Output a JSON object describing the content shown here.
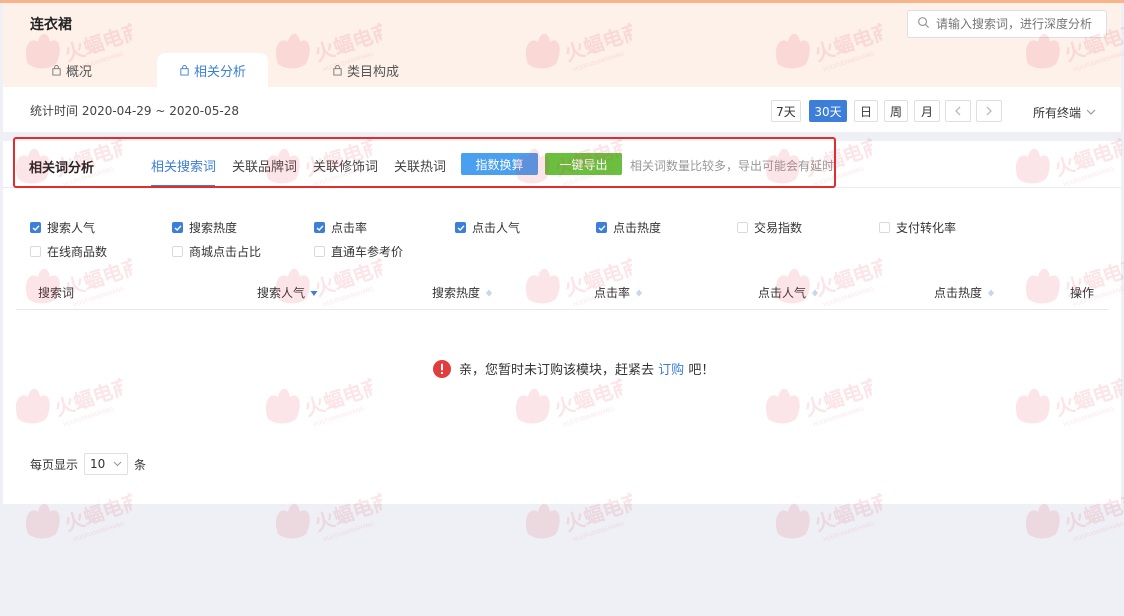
{
  "category_title": "连衣裙",
  "search": {
    "placeholder": "请输入搜索词，进行深度分析"
  },
  "tabs": [
    {
      "label": "概况",
      "icon": "bag-icon",
      "active": false
    },
    {
      "label": "相关分析",
      "icon": "bag-icon",
      "active": true
    },
    {
      "label": "类目构成",
      "icon": "bag-icon",
      "active": false
    }
  ],
  "date_range": {
    "label": "统计时间 2020-04-29 ~ 2020-05-28"
  },
  "range_buttons": [
    "7天",
    "30天",
    "日",
    "周",
    "月"
  ],
  "active_range": "30天",
  "device_select": "所有终端",
  "section": {
    "title": "相关词分析",
    "sub_tabs": [
      "相关搜索词",
      "关联品牌词",
      "关联修饰词",
      "关联热词"
    ],
    "active_sub_tab": "相关搜索词",
    "index_convert_button": "指数换算",
    "export_button": "一键导出",
    "export_note": "相关词数量比较多，导出可能会有延时"
  },
  "metrics": [
    {
      "label": "搜索人气",
      "checked": true
    },
    {
      "label": "搜索热度",
      "checked": true
    },
    {
      "label": "点击率",
      "checked": true
    },
    {
      "label": "点击人气",
      "checked": true
    },
    {
      "label": "点击热度",
      "checked": true
    },
    {
      "label": "交易指数",
      "checked": false
    },
    {
      "label": "支付转化率",
      "checked": false
    },
    {
      "label": "在线商品数",
      "checked": false
    },
    {
      "label": "商城点击占比",
      "checked": false
    },
    {
      "label": "直通车参考价",
      "checked": false
    }
  ],
  "table": {
    "columns": [
      "搜索词",
      "搜索人气",
      "搜索热度",
      "点击率",
      "点击人气",
      "点击热度",
      "操作"
    ],
    "empty_message": {
      "prefix": "亲，您暂时未订购该模块，赶紧去",
      "link": "订购",
      "suffix": "吧！"
    }
  },
  "pagination": {
    "label": "每页显示",
    "page_size": "10",
    "unit": "条"
  },
  "watermark": {
    "cn": "火蝠电商",
    "en": "HUOFUDIANSHANG"
  },
  "colors": {
    "accent": "#3c7ed8",
    "export_green": "#6bbf3e",
    "convert_blue": "#4a9ff0",
    "highlight_red": "#e12d2d",
    "header_band": "#fdf1ea"
  }
}
